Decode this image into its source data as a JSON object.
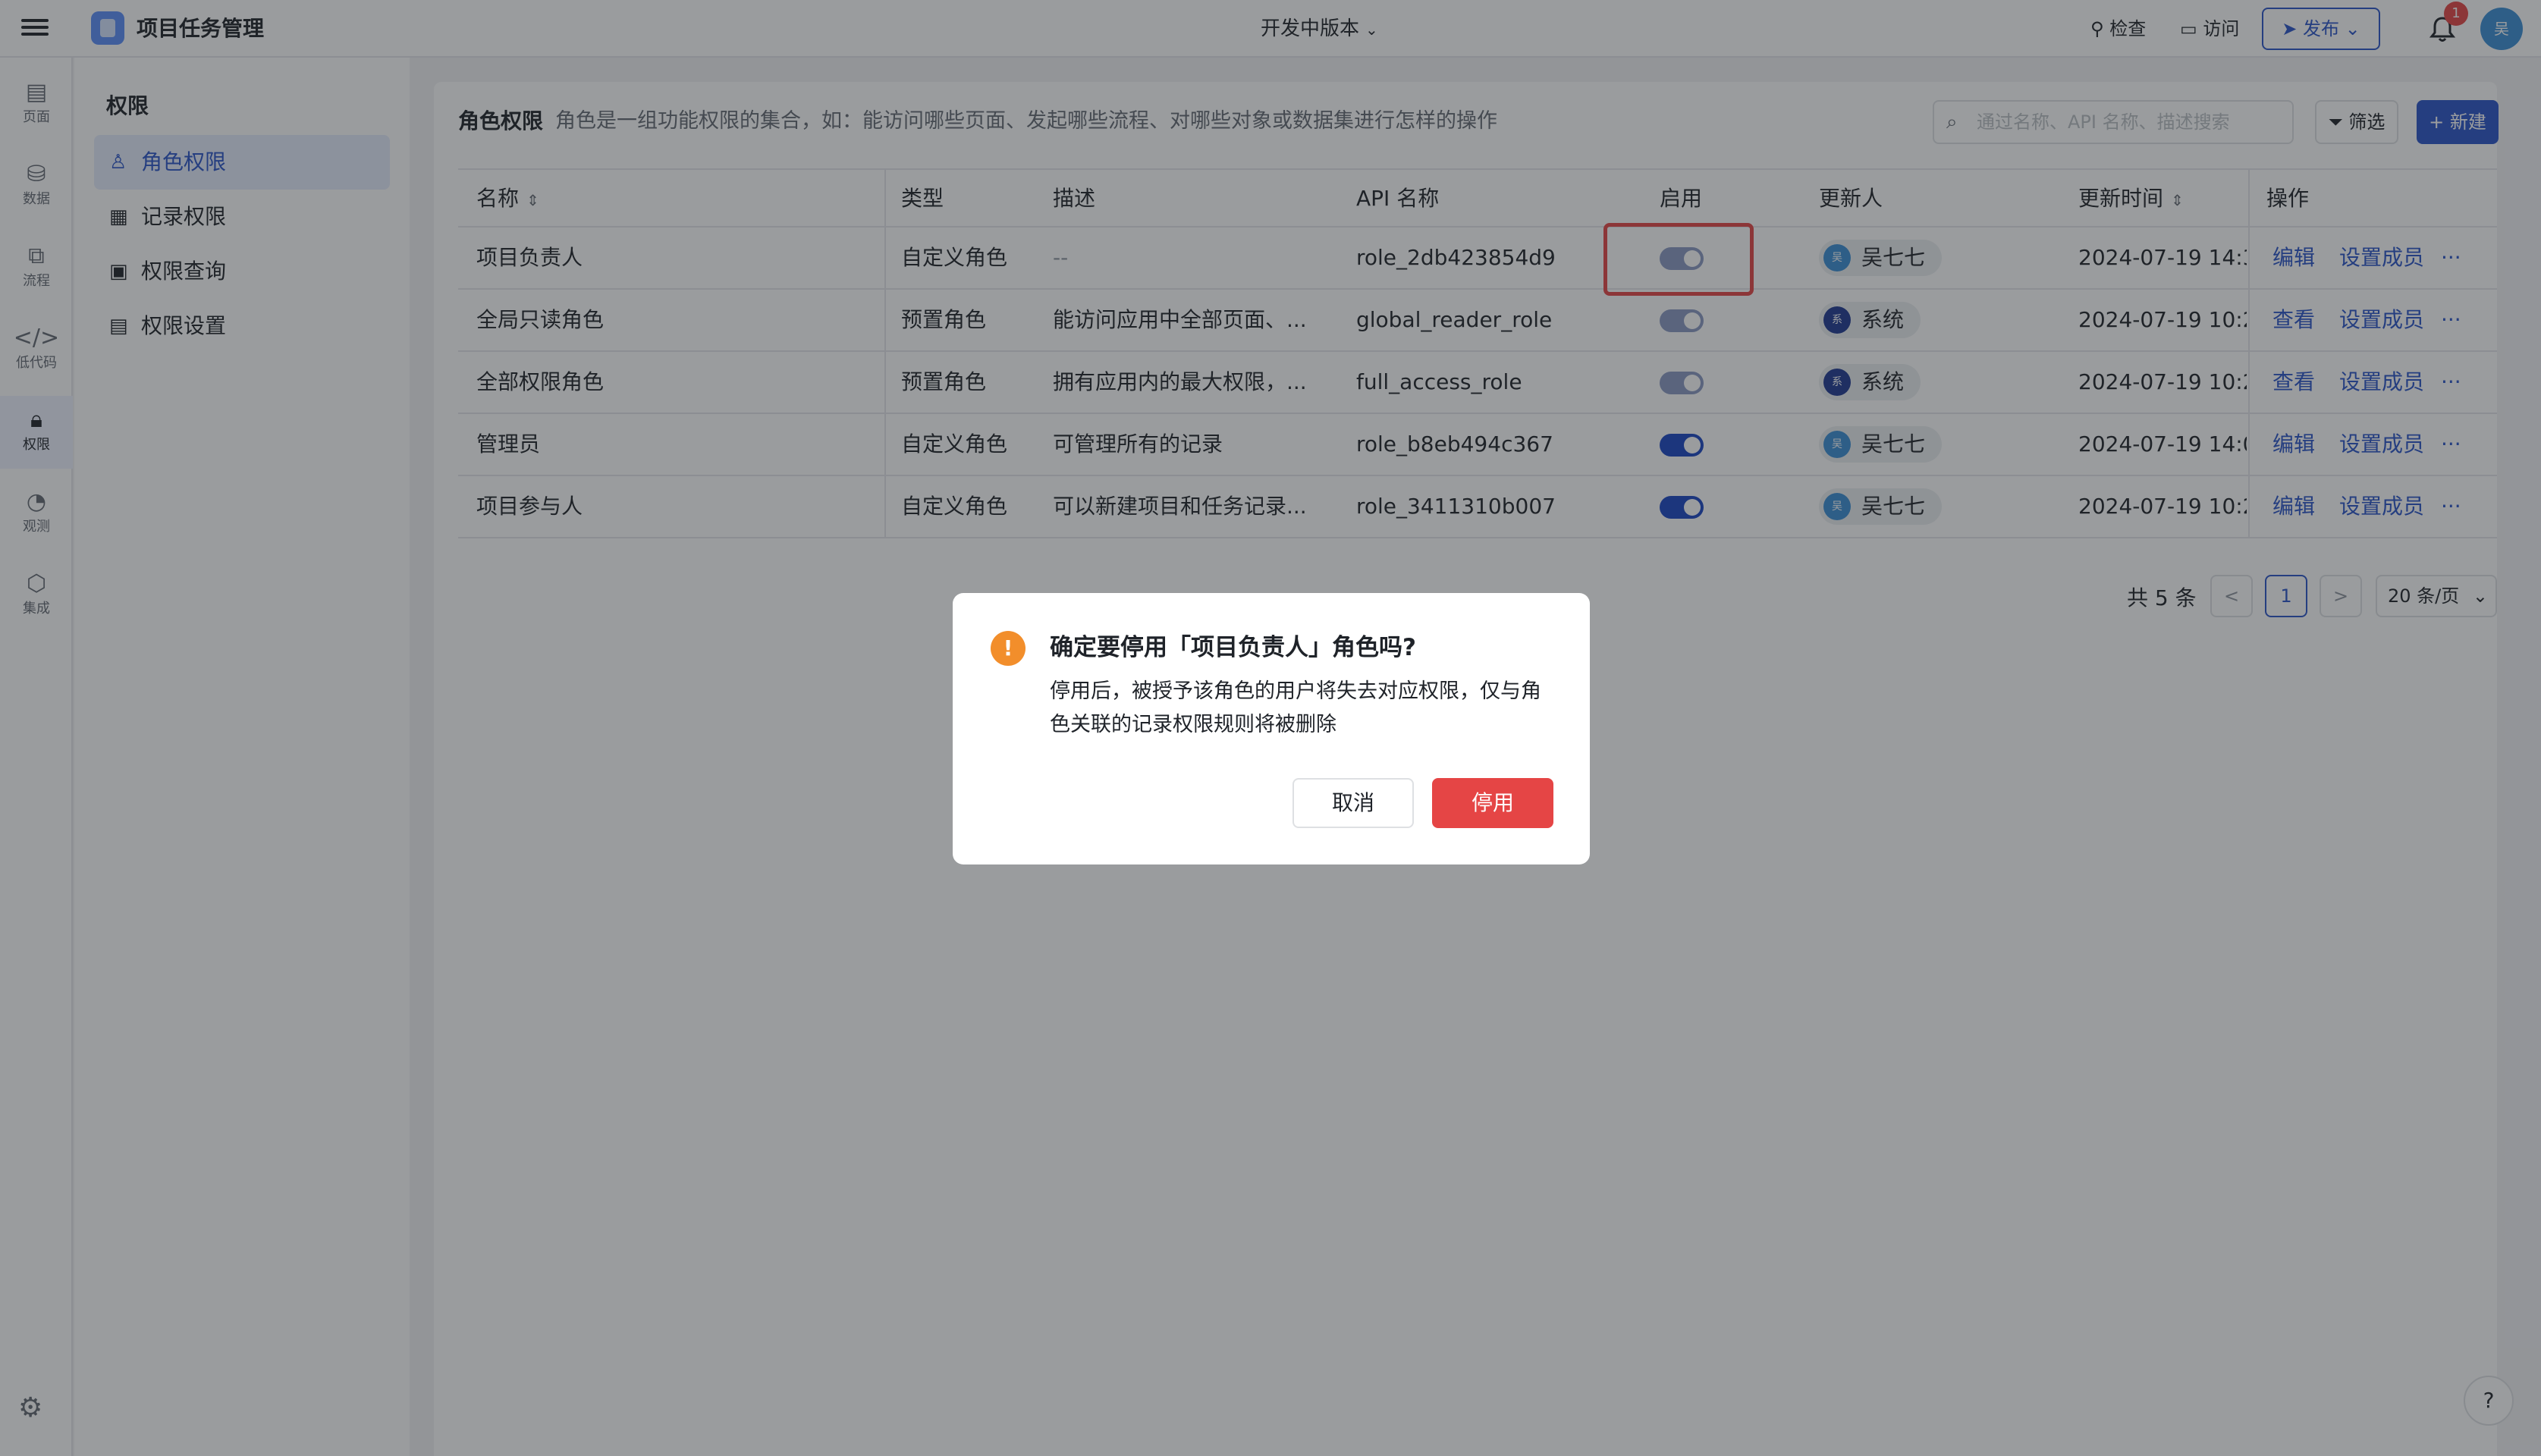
{
  "topbar": {
    "app_title": "项目任务管理",
    "version": "开发中版本",
    "check_label": "检查",
    "visit_label": "访问",
    "publish_label": "发布",
    "notif_count": "1",
    "avatar": "吴"
  },
  "rail": {
    "items": [
      {
        "label": "页面",
        "icon": "page-icon"
      },
      {
        "label": "数据",
        "icon": "database-icon"
      },
      {
        "label": "流程",
        "icon": "flow-icon"
      },
      {
        "label": "低代码",
        "icon": "code-icon"
      },
      {
        "label": "权限",
        "icon": "lock-icon"
      },
      {
        "label": "观测",
        "icon": "monitor-icon"
      },
      {
        "label": "集成",
        "icon": "cube-icon"
      }
    ]
  },
  "subside": {
    "title": "权限",
    "items": [
      {
        "label": "角色权限"
      },
      {
        "label": "记录权限"
      },
      {
        "label": "权限查询"
      },
      {
        "label": "权限设置"
      }
    ]
  },
  "main": {
    "title": "角色权限",
    "description": "角色是一组功能权限的集合，如：能访问哪些页面、发起哪些流程、对哪些对象或数据集进行怎样的操作",
    "search_placeholder": "通过名称、API 名称、描述搜索",
    "filter_label": "筛选",
    "new_label": "新建"
  },
  "table": {
    "columns": [
      "名称",
      "类型",
      "描述",
      "API 名称",
      "启用",
      "更新人",
      "更新时间",
      "操作"
    ],
    "rows": [
      {
        "name": "项目负责人",
        "type": "自定义角色",
        "desc": "--",
        "api": "role_2db423854d9",
        "enabled": "on-pending",
        "updater": "吴七七",
        "updater_av": "吴",
        "time": "2024-07-19 14:3",
        "op1": "编辑",
        "op2": "设置成员"
      },
      {
        "name": "全局只读角色",
        "type": "预置角色",
        "desc": "能访问应用中全部页面、...",
        "api": "global_reader_role",
        "enabled": "on-locked",
        "updater": "系统",
        "updater_av": "系",
        "time": "2024-07-19 10:2",
        "op1": "查看",
        "op2": "设置成员"
      },
      {
        "name": "全部权限角色",
        "type": "预置角色",
        "desc": "拥有应用内的最大权限，...",
        "api": "full_access_role",
        "enabled": "on-locked",
        "updater": "系统",
        "updater_av": "系",
        "time": "2024-07-19 10:2",
        "op1": "查看",
        "op2": "设置成员"
      },
      {
        "name": "管理员",
        "type": "自定义角色",
        "desc": "可管理所有的记录",
        "api": "role_b8eb494c367",
        "enabled": "on",
        "updater": "吴七七",
        "updater_av": "吴",
        "time": "2024-07-19 14:0",
        "op1": "编辑",
        "op2": "设置成员"
      },
      {
        "name": "项目参与人",
        "type": "自定义角色",
        "desc": "可以新建项目和任务记录...",
        "api": "role_3411310b007",
        "enabled": "on",
        "updater": "吴七七",
        "updater_av": "吴",
        "time": "2024-07-19 10:2",
        "op1": "编辑",
        "op2": "设置成员"
      }
    ],
    "more_label": "···"
  },
  "pagination": {
    "total": "共 5 条",
    "prev": "<",
    "current": "1",
    "next": ">",
    "page_size": "20 条/页"
  },
  "dialog": {
    "title": "确定要停用「项目负责人」角色吗?",
    "body": "停用后，被授予该角色的用户将失去对应权限，仅与角色关联的记录权限规则将被删除",
    "cancel_label": "取消",
    "confirm_label": "停用",
    "warn_glyph": "!"
  },
  "help_glyph": "?",
  "colors": {
    "accent": "#2a55c8",
    "danger": "#e54545",
    "warning": "#f28e2b",
    "toggle_on": "#1a46c4",
    "toggle_disabled": "#8a9ac4"
  }
}
